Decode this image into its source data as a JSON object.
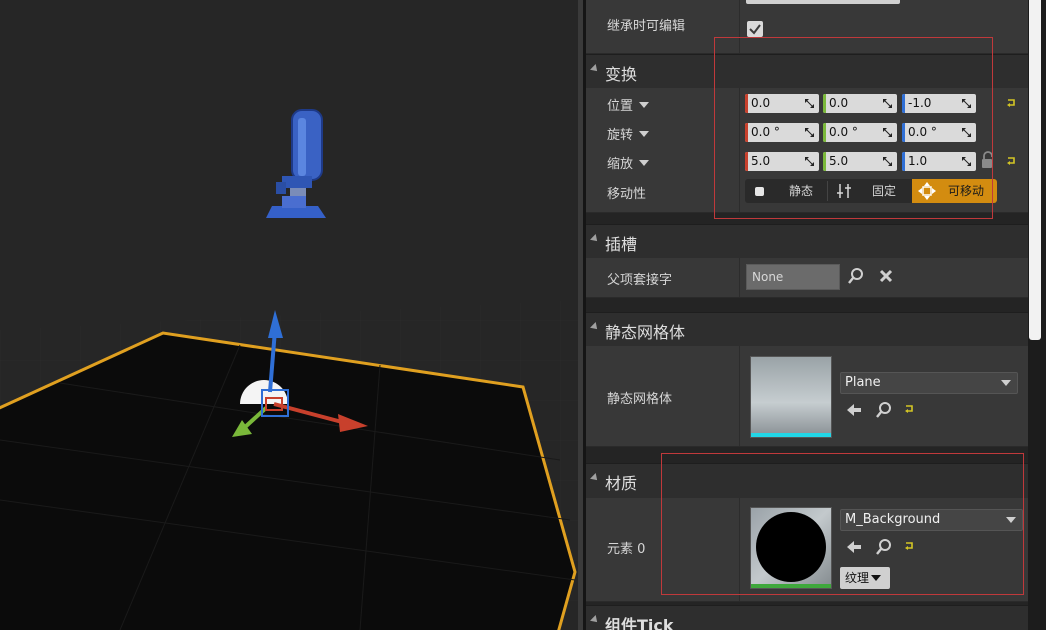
{
  "viewport": {
    "gizmo_axes": [
      "x-axis-arrow",
      "y-axis-arrow",
      "z-axis-arrow"
    ]
  },
  "details": {
    "inherit_edit": {
      "label": "继承时可编辑",
      "checked": true
    },
    "transform": {
      "title": "变换",
      "location": {
        "label": "位置",
        "x": "0.0",
        "y": "0.0",
        "z": "-1.0"
      },
      "rotation": {
        "label": "旋转",
        "x": "0.0 °",
        "y": "0.0 °",
        "z": "0.0 °"
      },
      "scale": {
        "label": "缩放",
        "x": "5.0",
        "y": "5.0",
        "z": "1.0"
      },
      "mobility": {
        "label": "移动性",
        "static": "静态",
        "stationary": "固定",
        "movable": "可移动",
        "selected": "movable"
      }
    },
    "sockets": {
      "title": "插槽",
      "parent_socket": {
        "label": "父项套接字",
        "value": "None"
      }
    },
    "static_mesh": {
      "title": "静态网格体",
      "label": "静态网格体",
      "asset": "Plane"
    },
    "materials": {
      "title": "材质",
      "element0": {
        "label": "元素 0",
        "asset": "M_Background",
        "texture_button": "纹理"
      }
    },
    "component_tick": {
      "title": "组件Tick"
    }
  },
  "colors": {
    "x_axis": "#c8402c",
    "y_axis": "#7ab83a",
    "z_axis": "#2f6fd6",
    "selected_mobility": "#d38c10",
    "selection_outline": "#e0a020",
    "highlight_box": "#c0393b",
    "reset_arrow": "#d4c624"
  }
}
